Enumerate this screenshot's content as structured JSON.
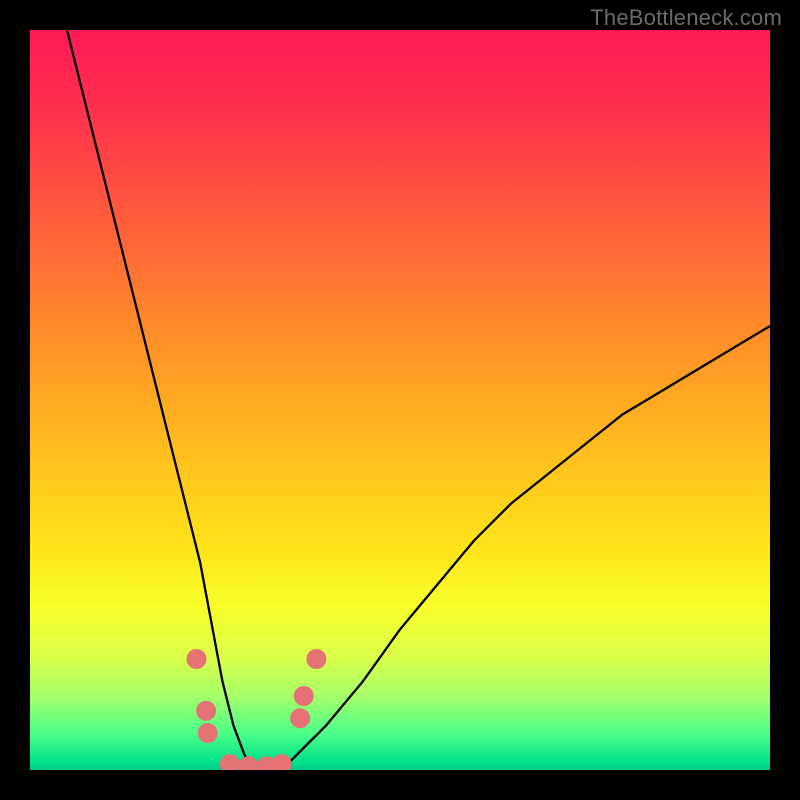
{
  "watermark": "TheBottleneck.com",
  "chart_data": {
    "type": "line",
    "title": "",
    "xlabel": "",
    "ylabel": "",
    "xlim": [
      0,
      100
    ],
    "ylim": [
      0,
      100
    ],
    "grid": false,
    "legend": false,
    "series": [
      {
        "name": "bottleneck-curve",
        "x": [
          5,
          8,
          11,
          14,
          17,
          20,
          23,
          24.5,
          26,
          27.5,
          29,
          30.5,
          32,
          34,
          36,
          40,
          45,
          50,
          55,
          60,
          65,
          70,
          75,
          80,
          85,
          90,
          95,
          100
        ],
        "y": [
          100,
          88,
          76,
          64,
          52,
          40,
          28,
          20,
          12,
          6,
          2,
          0,
          0,
          0,
          2,
          6,
          12,
          19,
          25,
          31,
          36,
          40,
          44,
          48,
          51,
          54,
          57,
          60
        ]
      }
    ],
    "markers": [
      {
        "name": "point-a",
        "x": 22.5,
        "y": 15
      },
      {
        "name": "point-b",
        "x": 23.8,
        "y": 8
      },
      {
        "name": "point-c",
        "x": 24.0,
        "y": 5
      },
      {
        "name": "point-d",
        "x": 27.0,
        "y": 0.8
      },
      {
        "name": "point-e",
        "x": 29.5,
        "y": 0.5
      },
      {
        "name": "point-f",
        "x": 32.0,
        "y": 0.5
      },
      {
        "name": "point-g",
        "x": 34.0,
        "y": 0.8
      },
      {
        "name": "point-h",
        "x": 36.5,
        "y": 7
      },
      {
        "name": "point-i",
        "x": 37.0,
        "y": 10
      },
      {
        "name": "point-j",
        "x": 38.7,
        "y": 15
      }
    ],
    "marker_color": "#e57373",
    "curve_color": "#000000",
    "background_gradient": {
      "top": "#ff1a57",
      "middle": "#ffe41a",
      "bottom": "#00e08a"
    }
  }
}
